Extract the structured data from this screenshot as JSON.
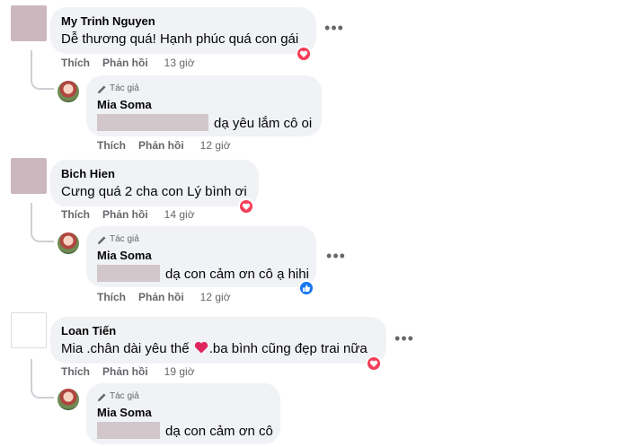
{
  "comments": [
    {
      "author": "My Trinh Nguyen",
      "text": "Dễ thương quá! Hạnh phúc quá con gái",
      "like_label": "Thích",
      "reply_label": "Phản hồi",
      "time": "13 giờ",
      "reaction": "love-icon",
      "reply": {
        "badge": "Tác giả",
        "author": "Mia Soma",
        "text": "dạ yêu lắm cô oi",
        "like_label": "Thích",
        "reply_label": "Phản hồi",
        "time": "12 giờ"
      }
    },
    {
      "author": "Bich Hien",
      "text": "Cưng quá 2 cha con Lý bình ơi",
      "like_label": "Thích",
      "reply_label": "Phản hồi",
      "time": "14 giờ",
      "reaction": "love-icon",
      "reply": {
        "badge": "Tác giả",
        "author": "Mia Soma",
        "text": "dạ con cảm ơn cô ạ hihi",
        "like_label": "Thích",
        "reply_label": "Phản hồi",
        "time": "12 giờ",
        "reaction": "like-icon"
      }
    },
    {
      "author": "Loan Tiến",
      "text_before": "Mia .chân dài yêu thế",
      "text_after": ".ba bình cũng đẹp trai nữa",
      "like_label": "Thích",
      "reply_label": "Phản hồi",
      "time": "19 giờ",
      "reaction": "love-icon",
      "reply": {
        "badge": "Tác giả",
        "author": "Mia Soma",
        "text": "dạ con cảm ơn cô"
      }
    }
  ],
  "more_label": "•••",
  "colors": {
    "love": "#f33e58",
    "like": "#1877f2",
    "bubble": "#f0f2f5",
    "meta": "#65676b"
  }
}
